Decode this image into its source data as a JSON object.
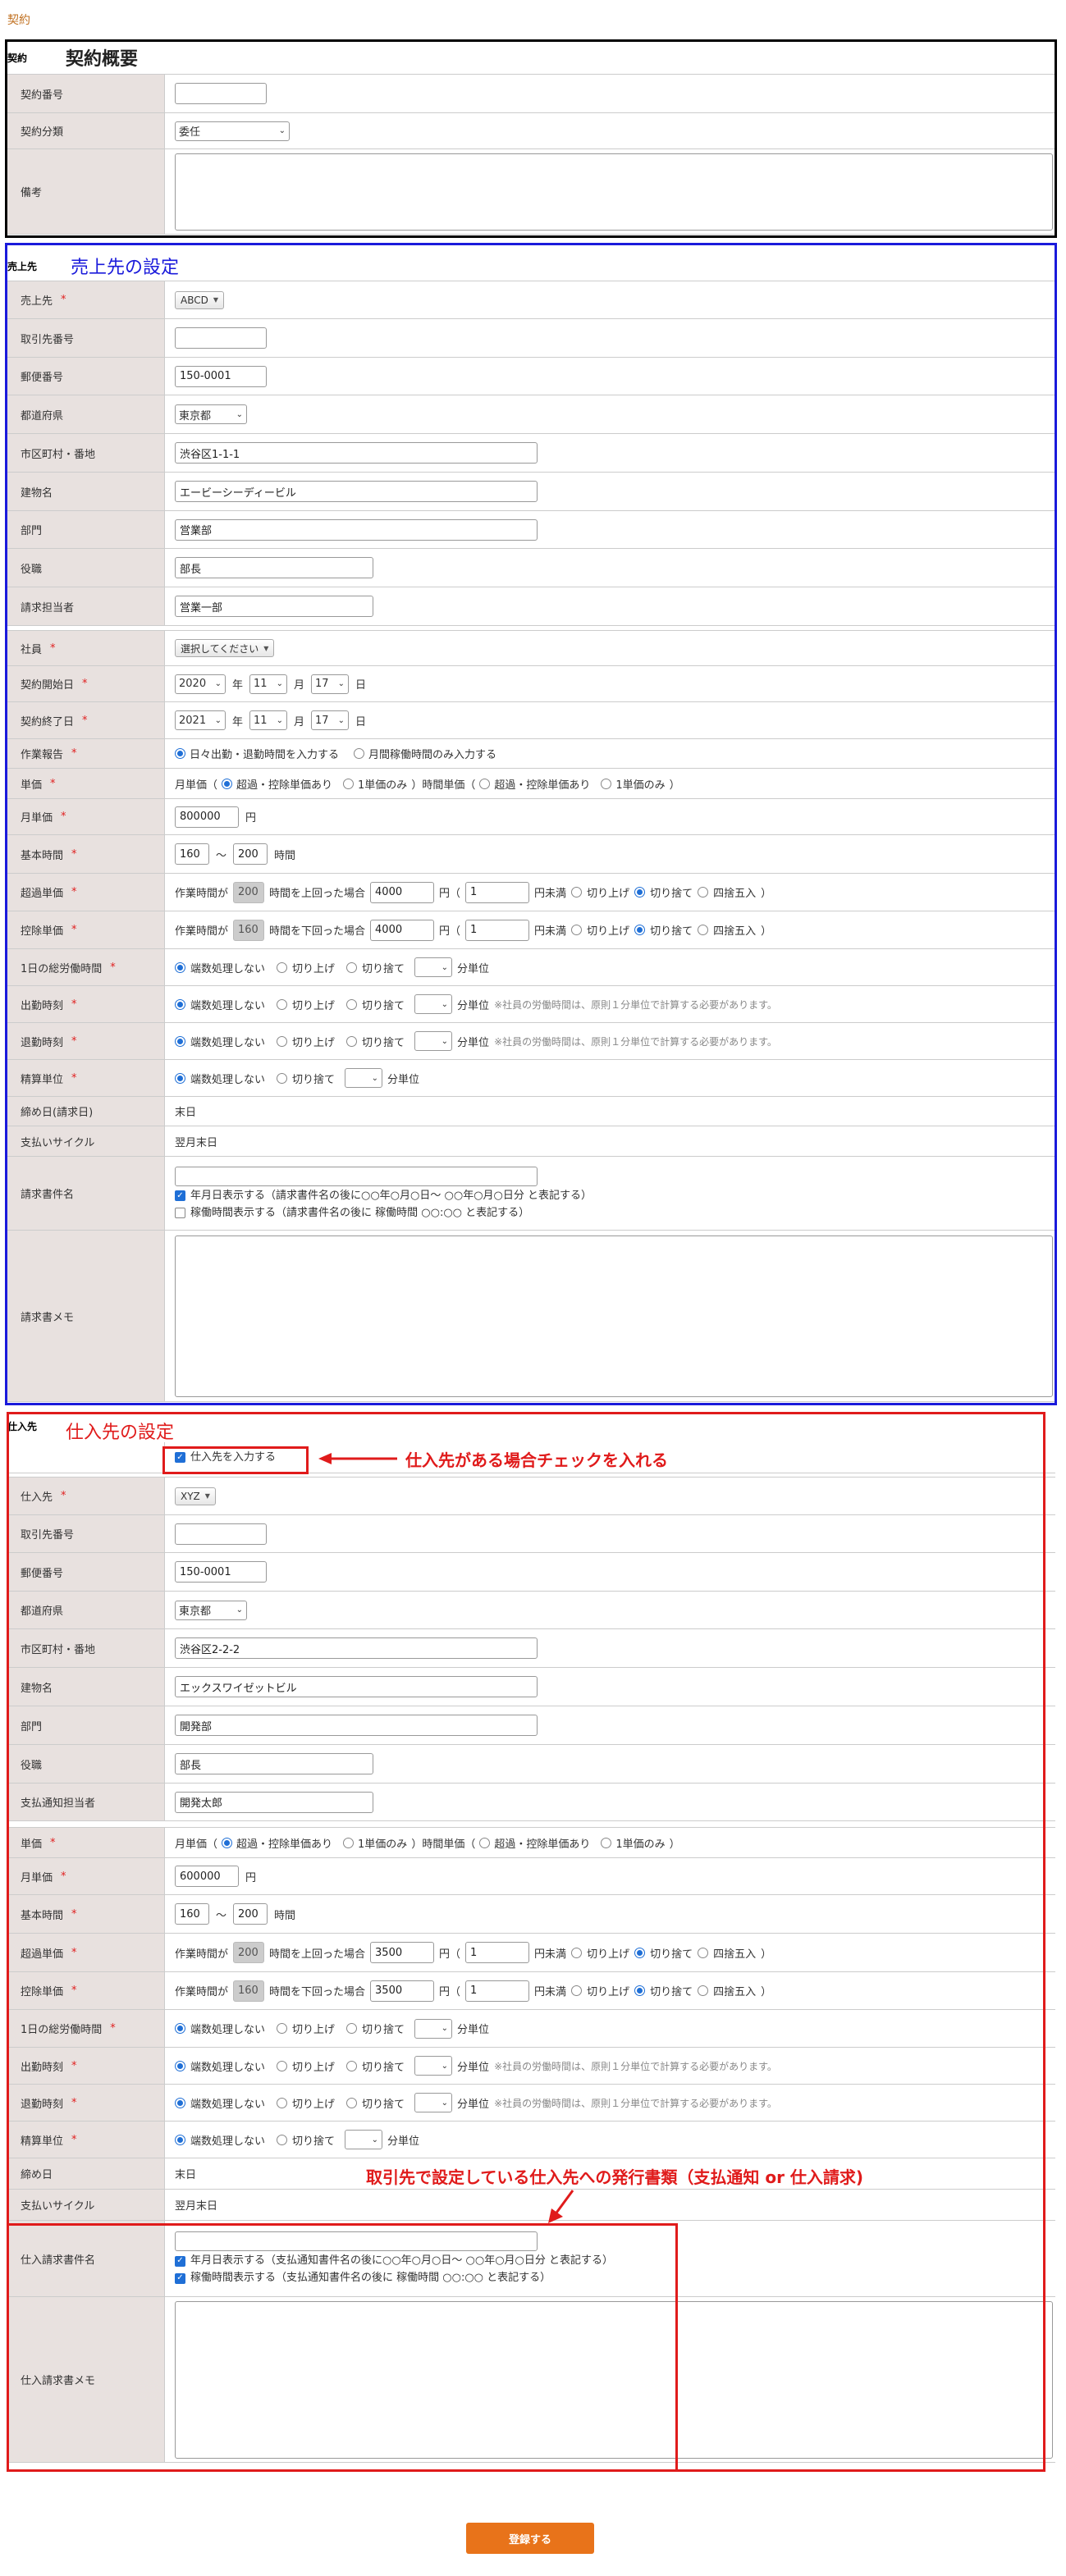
{
  "page_label": "契約",
  "contract": {
    "tag": "契約",
    "heading": "契約概要",
    "number_label": "契約番号",
    "number_value": "",
    "category_label": "契約分類",
    "category_value": "委任",
    "remarks_label": "備考"
  },
  "customer": {
    "tag": "売上先",
    "heading": "売上先の設定",
    "client_label": "売上先",
    "client_value": "ABCD",
    "client_code_label": "取引先番号",
    "postal_label": "郵便番号",
    "postal_value": "150-0001",
    "prefecture_label": "都道府県",
    "prefecture_value": "東京都",
    "city_label": "市区町村・番地",
    "city_value": "渋谷区1-1-1",
    "building_label": "建物名",
    "building_value": "エービーシーディービル",
    "department_label": "部門",
    "department_value": "営業部",
    "position_label": "役職",
    "position_value": "部長",
    "billing_person_label": "請求担当者",
    "billing_person_value": "営業一部",
    "employee_label": "社員",
    "employee_value": "選択してください",
    "start_label": "契約開始日",
    "start_year": "2020",
    "start_month": "11",
    "start_day": "17",
    "end_label": "契約終了日",
    "end_year": "2021",
    "end_month": "11",
    "end_day": "17",
    "report_label": "作業報告",
    "report_opt1": "日々出勤・退勤時間を入力する",
    "report_opt2": "月間稼働時間のみ入力する",
    "unit_label": "単価",
    "monthly_price_label": "月単価",
    "monthly_price_value": "800000",
    "base_hours_label": "基本時間",
    "base_min": "160",
    "base_max": "200",
    "over_label": "超過単価",
    "over_hours": "200",
    "over_price": "4000",
    "deduct_label": "控除単価",
    "deduct_hours": "160",
    "deduct_price": "4000",
    "daily_hours_label": "1日の総労働時間",
    "clock_in_label": "出勤時刻",
    "clock_out_label": "退勤時刻",
    "settle_label": "精算単位",
    "closing_label": "締め日(請求日)",
    "closing_value": "末日",
    "cycle_label": "支払いサイクル",
    "cycle_value": "翌月末日",
    "invoice_name_label": "請求書件名",
    "invoice_chk1": "年月日表示する（請求書件名の後に○○年○月○日～ ○○年○月○日分 と表記する）",
    "invoice_chk2": "稼働時間表示する（請求書件名の後に 稼働時間 ○○:○○ と表記する）",
    "memo_label": "請求書メモ"
  },
  "supplier": {
    "tag": "仕入先",
    "heading": "仕入先の設定",
    "enable_label": "仕入先を入力する",
    "client_label": "仕入先",
    "client_value": "XYZ",
    "client_code_label": "取引先番号",
    "postal_label": "郵便番号",
    "postal_value": "150-0001",
    "prefecture_label": "都道府県",
    "prefecture_value": "東京都",
    "city_label": "市区町村・番地",
    "city_value": "渋谷区2-2-2",
    "building_label": "建物名",
    "building_value": "エックスワイゼットビル",
    "department_label": "部門",
    "department_value": "開発部",
    "position_label": "役職",
    "position_value": "部長",
    "payment_person_label": "支払通知担当者",
    "payment_person_value": "開発太郎",
    "unit_label": "単価",
    "monthly_price_label": "月単価",
    "monthly_price_value": "600000",
    "base_hours_label": "基本時間",
    "base_min": "160",
    "base_max": "200",
    "over_label": "超過単価",
    "over_hours": "200",
    "over_price": "3500",
    "deduct_label": "控除単価",
    "deduct_hours": "160",
    "deduct_price": "3500",
    "daily_hours_label": "1日の総労働時間",
    "clock_in_label": "出勤時刻",
    "clock_out_label": "退勤時刻",
    "settle_label": "精算単位",
    "closing_label": "締め日",
    "closing_value": "末日",
    "cycle_label": "支払いサイクル",
    "cycle_value": "翌月末日",
    "invoice_name_label": "仕入請求書件名",
    "invoice_chk1": "年月日表示する（支払通知書件名の後に○○年○月○日～ ○○年○月○日分 と表記する）",
    "invoice_chk2": "稼働時間表示する（支払通知書件名の後に 稼働時間 ○○:○○ と表記する）",
    "memo_label": "仕入請求書メモ"
  },
  "common": {
    "year": "年",
    "month": "月",
    "day": "日",
    "yen": "円",
    "hours": "時間",
    "tilde": "〜",
    "unit_price_lead": "月単価（",
    "unit_opt1": "超過・控除単価あり",
    "unit_opt2": "1単価のみ",
    "unit_mid": "）時間単価（",
    "unit_end": "）",
    "over_prefix": "作業時間が",
    "over_suffix": "時間を上回った場合",
    "deduct_suffix": "時間を下回った場合",
    "yen_paren": "円（",
    "fraction": "1",
    "below_yen": "円未満",
    "round_up": "切り上げ",
    "round_down": "切り捨て",
    "round_half": "四捨五入",
    "close_paren": "）",
    "no_rounding": "端数処理しない",
    "minute_unit": "分単位",
    "employee_note": "※社員の労働時間は、原則１分単位で計算する必要があります。",
    "required": "*",
    "submit": "登録する"
  },
  "annotations": {
    "supplier_check": "仕入先がある場合チェックを入れる",
    "doc_type": "取引先で設定している仕入先への発行書類（支払通知 or 仕入請求)"
  },
  "colors": {
    "contract_frame": "#000000",
    "customer_frame": "#1a1adb",
    "supplier_frame": "#e01b1b",
    "submit": "#e8731a",
    "label_bg": "#e8e1df"
  }
}
